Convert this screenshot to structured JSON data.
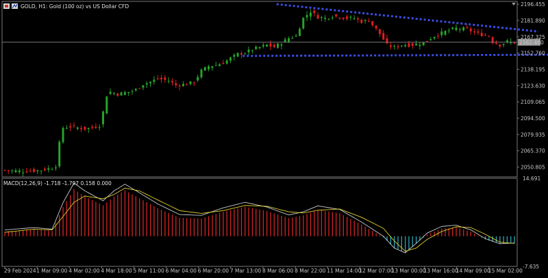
{
  "window": {
    "title": "GOLD, H1:  Gold (100 oz) vs US Dollar CFD",
    "buttons": [
      "chart-type-icon",
      "indicator-icon"
    ]
  },
  "colors": {
    "background": "#000000",
    "frame": "#7a7a7a",
    "bull_candle": "#26a32a",
    "bear_candle": "#e11d1d",
    "trendline": "#3b4de0",
    "price_line": "#8c8c8c",
    "price_tag_bg": "#9a9a9a",
    "macd_hist_up": "#d42525",
    "macd_hist_down": "#2aa7b8",
    "macd_line": "#c9c9c9",
    "signal_line": "#e3cf2b"
  },
  "chart_data": [
    {
      "type": "candlestick",
      "symbol": "GOLD",
      "timeframe": "H1",
      "current_price": "2162.460",
      "y_ticks": [
        "2196.455",
        "2181.890",
        "2167.325",
        "2152.760",
        "2138.195",
        "2123.630",
        "2109.065",
        "2094.500",
        "2079.935",
        "2065.370",
        "2050.805"
      ],
      "ylim": [
        2042.0,
        2199.0
      ],
      "x_ticks": [
        "29 Feb 2024",
        "1 Mar 09:00",
        "4 Mar 02:00",
        "4 Mar 18:00",
        "5 Mar 11:00",
        "6 Mar 04:00",
        "6 Mar 20:00",
        "7 Mar 13:00",
        "8 Mar 06:00",
        "8 Mar 22:00",
        "11 Mar 14:00",
        "12 Mar 07:00",
        "13 Mar 00:00",
        "13 Mar 16:00",
        "14 Mar 09:00",
        "15 Mar 02:00"
      ],
      "close_path": [
        [
          0,
          2048
        ],
        [
          5,
          2047
        ],
        [
          10,
          2048
        ],
        [
          13,
          2050
        ],
        [
          14,
          2052
        ],
        [
          15,
          2072
        ],
        [
          16,
          2086
        ],
        [
          18,
          2087
        ],
        [
          22,
          2085
        ],
        [
          24,
          2086
        ],
        [
          26,
          2088
        ],
        [
          27,
          2100
        ],
        [
          28,
          2115
        ],
        [
          29,
          2118
        ],
        [
          31,
          2116
        ],
        [
          34,
          2118
        ],
        [
          36,
          2120
        ],
        [
          38,
          2125
        ],
        [
          40,
          2127
        ],
        [
          42,
          2130
        ],
        [
          45,
          2128
        ],
        [
          47,
          2124
        ],
        [
          50,
          2125
        ],
        [
          52,
          2127
        ],
        [
          54,
          2137
        ],
        [
          56,
          2141
        ],
        [
          58,
          2142
        ],
        [
          60,
          2144
        ],
        [
          62,
          2148
        ],
        [
          64,
          2152
        ],
        [
          66,
          2153
        ],
        [
          68,
          2156
        ],
        [
          70,
          2158
        ],
        [
          72,
          2160
        ],
        [
          74,
          2158
        ],
        [
          76,
          2162
        ],
        [
          78,
          2166
        ],
        [
          80,
          2168
        ],
        [
          82,
          2184
        ],
        [
          84,
          2190
        ],
        [
          86,
          2185
        ],
        [
          88,
          2184
        ],
        [
          90,
          2186
        ],
        [
          92,
          2185
        ],
        [
          94,
          2184
        ],
        [
          96,
          2184
        ],
        [
          98,
          2181
        ],
        [
          100,
          2182
        ],
        [
          103,
          2170
        ],
        [
          105,
          2160
        ],
        [
          107,
          2158
        ],
        [
          109,
          2160
        ],
        [
          112,
          2160
        ],
        [
          115,
          2162
        ],
        [
          118,
          2168
        ],
        [
          121,
          2172
        ],
        [
          124,
          2175
        ],
        [
          127,
          2174
        ],
        [
          130,
          2170
        ],
        [
          133,
          2168
        ],
        [
          134,
          2163
        ],
        [
          136,
          2160
        ],
        [
          138,
          2163
        ],
        [
          140,
          2162
        ]
      ],
      "trendlines": [
        {
          "name": "upper",
          "from": [
            "8 Mar 06:00",
            2196.5
          ],
          "to": [
            "15 Mar 02:00",
            2173.5
          ]
        },
        {
          "name": "lower",
          "from": [
            "7 Mar 13:00",
            2150.2
          ],
          "to": [
            "15 Mar 02:00",
            2151.3
          ]
        }
      ]
    },
    {
      "type": "macd",
      "title": "MACD(12,26,9) -1.718 -1.797 0.158 0.000",
      "y_ticks": [
        "14.691",
        "-7.635"
      ],
      "ylim": [
        -7.635,
        14.691
      ],
      "macd_path": [
        [
          0,
          1.6
        ],
        [
          8,
          2.2
        ],
        [
          13,
          1.8
        ],
        [
          16,
          8.5
        ],
        [
          19,
          13.5
        ],
        [
          22,
          11.5
        ],
        [
          27,
          9.0
        ],
        [
          30,
          11.5
        ],
        [
          33,
          13.2
        ],
        [
          37,
          11.0
        ],
        [
          42,
          8.2
        ],
        [
          48,
          5.5
        ],
        [
          54,
          5.3
        ],
        [
          60,
          7.2
        ],
        [
          66,
          8.6
        ],
        [
          72,
          7.4
        ],
        [
          78,
          5.4
        ],
        [
          82,
          6.2
        ],
        [
          86,
          7.7
        ],
        [
          92,
          6.8
        ],
        [
          98,
          3.6
        ],
        [
          104,
          0.0
        ],
        [
          107,
          -3.0
        ],
        [
          110,
          -4.2
        ],
        [
          113,
          -1.8
        ],
        [
          116,
          0.8
        ],
        [
          120,
          2.5
        ],
        [
          124,
          2.8
        ],
        [
          128,
          1.6
        ],
        [
          132,
          -0.6
        ],
        [
          136,
          -1.9
        ],
        [
          140,
          -1.7
        ]
      ],
      "signal_path": [
        [
          0,
          1.0
        ],
        [
          8,
          1.8
        ],
        [
          13,
          1.6
        ],
        [
          16,
          5.0
        ],
        [
          19,
          8.6
        ],
        [
          22,
          10.2
        ],
        [
          27,
          9.5
        ],
        [
          30,
          10.6
        ],
        [
          33,
          12.2
        ],
        [
          37,
          11.5
        ],
        [
          42,
          9.2
        ],
        [
          48,
          6.5
        ],
        [
          54,
          5.8
        ],
        [
          60,
          6.5
        ],
        [
          66,
          7.8
        ],
        [
          72,
          7.6
        ],
        [
          78,
          6.2
        ],
        [
          82,
          5.9
        ],
        [
          86,
          6.6
        ],
        [
          92,
          6.9
        ],
        [
          98,
          4.8
        ],
        [
          104,
          2.0
        ],
        [
          107,
          -1.2
        ],
        [
          110,
          -3.8
        ],
        [
          113,
          -3.0
        ],
        [
          116,
          -0.8
        ],
        [
          120,
          1.2
        ],
        [
          124,
          2.4
        ],
        [
          128,
          2.2
        ],
        [
          132,
          0.5
        ],
        [
          136,
          -1.5
        ],
        [
          140,
          -1.8
        ]
      ]
    }
  ]
}
